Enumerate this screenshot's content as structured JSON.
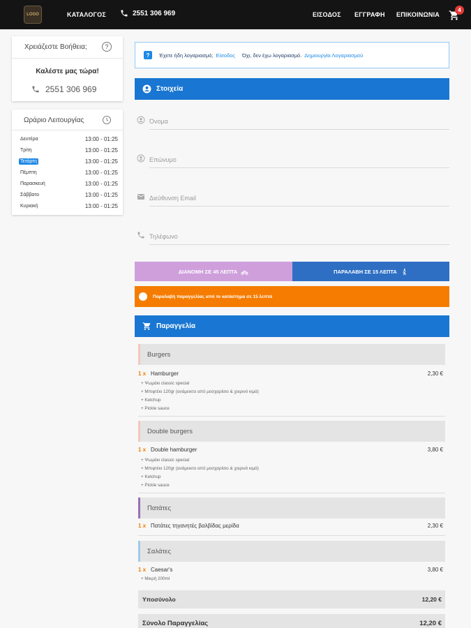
{
  "nav": {
    "logo_text": "LOGO",
    "catalog": "ΚΑΤΑΛΟΓΟΣ",
    "phone": "2551 306 969",
    "login": "ΕΙΣΟΔΟΣ",
    "register": "ΕΓΓΡΑΦΗ",
    "contact": "ΕΠΙΚΟΙΝΩΝΙΑ",
    "cart_count": "4"
  },
  "help": {
    "title": "Χρειάζεστε Βοήθεια;",
    "call_text": "Καλέστε μας τώρα!",
    "phone": "2551 306 969"
  },
  "hours": {
    "title": "Ωράριο Λειτουργίας",
    "days": [
      {
        "day": "Δευτέρα",
        "time": "13:00 - 01:25"
      },
      {
        "day": "Τρίτη",
        "time": "13:00 - 01:25"
      },
      {
        "day": "Τετάρτη",
        "time": "13:00 - 01:25"
      },
      {
        "day": "Πέμπτη",
        "time": "13:00 - 01:25"
      },
      {
        "day": "Παρασκευή",
        "time": "13:00 - 01:25"
      },
      {
        "day": "Σάββατο",
        "time": "13:00 - 01:25"
      },
      {
        "day": "Κυριακή",
        "time": "13:00 - 01:25"
      }
    ]
  },
  "login_box": {
    "has_account": "Έχετε ήδη λογαριασμό;",
    "login_link": "Είσοδος",
    "no_account": "Όχι, δεν έχω λογαριασμό.",
    "create_link": "Δημιουργία Λογαριασμού"
  },
  "details": {
    "title": "Στοιχεία",
    "name_placeholder": "Όνομα",
    "surname_placeholder": "Επώνυμο",
    "email_placeholder": "Διεύθυνση Email",
    "phone_placeholder": "Τηλέφωνο"
  },
  "delivery": {
    "delivery_label": "ΔΙΑΝΟΜΗ ΣΕ 45 ΛΕΠΤΑ",
    "pickup_label": "ΠΑΡΑΛΑΒΗ ΣΕ 15 ΛΕΠΤΑ",
    "notice": "Παραλαβή παραγγελίας από το κατάστημα σε 15 λεπτά"
  },
  "order": {
    "title": "Παραγγελία",
    "categories": [
      {
        "name": "Burgers",
        "color": "#f3c7c0",
        "items": [
          {
            "qty": "1 x",
            "name": "Hamburger",
            "price": "2,30 €",
            "extras": [
              "+ Ψωμάκι classic special",
              "+ Μπιφτέκι 120gr (ανάμεικτο από μοσχαρίσιο & χοιρινό κιμά)",
              "+ Ketchup",
              "+ Pickle sauce"
            ]
          }
        ]
      },
      {
        "name": "Double burgers",
        "color": "#f3c7c0",
        "items": [
          {
            "qty": "1 x",
            "name": "Double hamburger",
            "price": "3,80 €",
            "extras": [
              "+ Ψωμάκι classic special",
              "+ Μπιφτέκι 120gr (ανάμεικτο από μοσχαρίσιο & χοιρινό κιμά)",
              "+ Ketchup",
              "+ Pickle sauce"
            ]
          }
        ]
      },
      {
        "name": "Πατάτες",
        "color": "#9c6fb8",
        "items": [
          {
            "qty": "1 x",
            "name": "Πατάτες τηγανητές βαλβίδας μερίδα",
            "price": "2,30 €",
            "extras": []
          }
        ]
      },
      {
        "name": "Σαλάτες",
        "color": "#9fcbe8",
        "items": [
          {
            "qty": "1 x",
            "name": "Caesar's",
            "price": "3,80 €",
            "extras": [
              "+ Μικρή 200ml"
            ]
          }
        ]
      }
    ],
    "subtotal_label": "Υποσύνολο",
    "subtotal": "12,20 €",
    "total_label": "Σύνολο Παραγγελίας",
    "total": "12,20 €"
  },
  "colors": {
    "primary": "#1976d2",
    "accent_orange": "#f57c00",
    "delivery_bg": "#cf9fdc",
    "pickup_bg": "#2e6fc4",
    "topbar": "#141414"
  }
}
